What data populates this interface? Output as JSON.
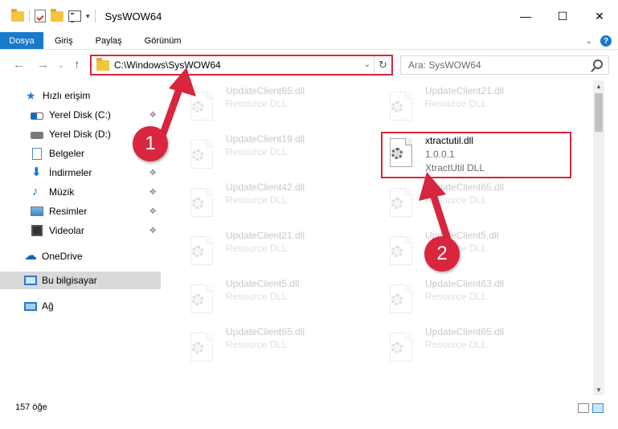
{
  "window": {
    "title": "SysWOW64",
    "minimize_label": "—",
    "maximize_label": "☐",
    "close_label": "✕"
  },
  "ribbon": {
    "tabs": [
      "Dosya",
      "Giriş",
      "Paylaş",
      "Görünüm"
    ]
  },
  "address": {
    "path": "C:\\Windows\\SysWOW64",
    "search_placeholder": "Ara: SysWOW64"
  },
  "sidebar": {
    "quick_access": "Hızlı erişim",
    "items": [
      {
        "label": "Yerel Disk (C:)",
        "icon": "drive-c-icon",
        "pinned": true
      },
      {
        "label": "Yerel Disk (D:)",
        "icon": "drive-d-icon",
        "pinned": false
      },
      {
        "label": "Belgeler",
        "icon": "documents-icon",
        "pinned": true
      },
      {
        "label": "İndirmeler",
        "icon": "downloads-icon",
        "pinned": true
      },
      {
        "label": "Müzik",
        "icon": "music-icon",
        "pinned": true
      },
      {
        "label": "Resimler",
        "icon": "pictures-icon",
        "pinned": true
      },
      {
        "label": "Videolar",
        "icon": "videos-icon",
        "pinned": true
      }
    ],
    "onedrive": "OneDrive",
    "this_pc": "Bu bilgisayar",
    "network": "Ağ"
  },
  "files": {
    "left_column": [
      {
        "name": "UpdateClient65.dll",
        "type": "Resource DLL"
      },
      {
        "name": "UpdateClient19.dll",
        "type": "Resource DLL"
      },
      {
        "name": "UpdateClient42.dll",
        "type": "Resource DLL"
      },
      {
        "name": "UpdateClient21.dll",
        "type": "Resource DLL"
      },
      {
        "name": "UpdateClient5.dll",
        "type": "Resource DLL"
      },
      {
        "name": "UpdateClient65.dll",
        "type": "Resource DLL"
      }
    ],
    "right_column": [
      {
        "name": "UpdateClient21.dll",
        "type": "Resource DLL"
      },
      {
        "name": "xtractutil.dll",
        "version": "1.0.0.1",
        "type": "XtractUtil DLL"
      },
      {
        "name": "UpdateClient65.dll",
        "type": "Resource DLL"
      },
      {
        "name": "UpdateClient5.dll",
        "type": "Resource DLL"
      },
      {
        "name": "UpdateClient63.dll",
        "type": "Resource DLL"
      },
      {
        "name": "UpdateClient65.dll",
        "type": "Resource DLL"
      }
    ]
  },
  "annotations": {
    "badge1": "1",
    "badge2": "2",
    "color": "#d7263d"
  },
  "status": {
    "item_count": "157 öğe"
  }
}
